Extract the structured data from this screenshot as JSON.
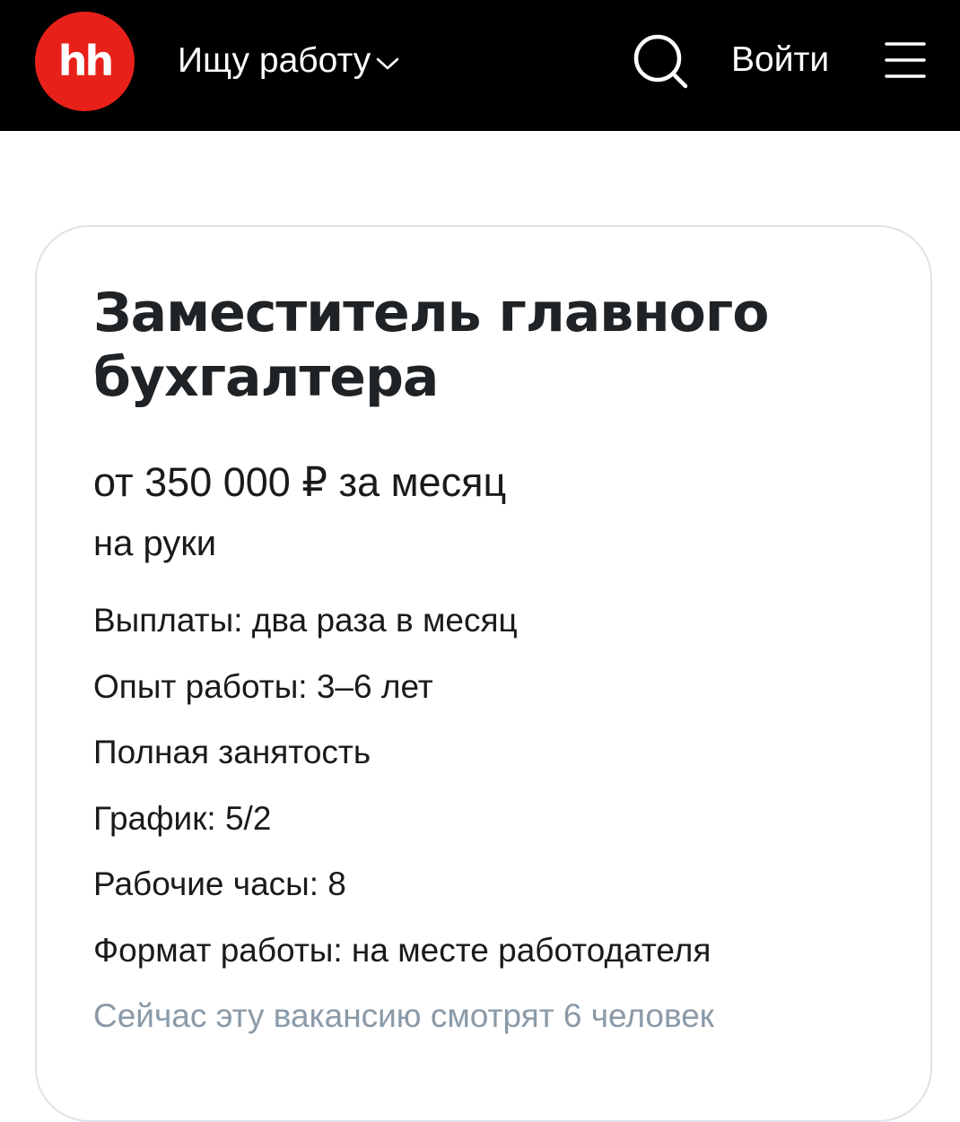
{
  "header": {
    "logo_text": "hh",
    "menu_label": "Ищу работу",
    "login_label": "Войти",
    "colors": {
      "background": "#000000",
      "logo": "#e8201a",
      "text": "#ffffff"
    },
    "icons": [
      "chevron-down-icon",
      "search-icon",
      "menu-icon"
    ]
  },
  "vacancy": {
    "title": "Заместитель главного бухгалтера",
    "salary": "от 350 000 ₽ за месяц",
    "salary_note": "на руки",
    "details": [
      "Выплаты: два раза в месяц",
      "Опыт работы: 3–6 лет",
      "Полная занятость",
      "График: 5/2",
      "Рабочие часы: 8",
      "Формат работы: на месте работодателя"
    ],
    "viewers": "Сейчас эту вакансию смотрят 6 человек",
    "colors": {
      "title": "#1f2326",
      "text": "#1a1a1a",
      "muted": "#8a9aa8",
      "card_border": "#dde3e8"
    }
  }
}
